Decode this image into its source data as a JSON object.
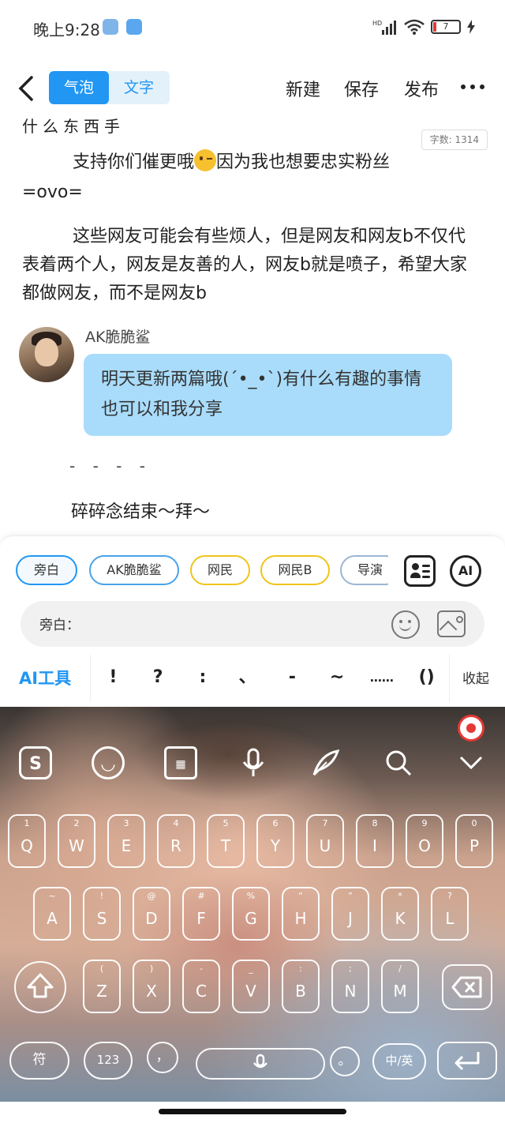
{
  "status_bar": {
    "time": "晚上9:28",
    "network": "HD",
    "battery": "7"
  },
  "header": {
    "mode_tabs": [
      "气泡",
      "文字"
    ],
    "active_tab": "气泡",
    "actions": {
      "new": "新建",
      "save": "保存",
      "publish": "发布"
    }
  },
  "editor": {
    "cut_line": "什么东西手",
    "word_count": "字数: 1314",
    "paragraph_1_before": "支持你们催更哦",
    "paragraph_1_after": "因为我也想要忠实粉丝",
    "paragraph_1_tail": "=ovo=",
    "paragraph_2": "这些网友可能会有些烦人，但是网友和网友b不仅代表着两个人，网友是友善的人，网友b就是喷子，希望大家都做网友，而不是网友b",
    "dialogue": {
      "character_name": "AK脆脆鲨",
      "message": "明天更新两篇哦(´•_•`)有什么有趣的事情也可以和我分享"
    },
    "divider": "- - - -",
    "closing": "碎碎念结束～拜～"
  },
  "character_panel": {
    "chips": [
      {
        "label": "旁白",
        "style": "sel"
      },
      {
        "label": "AK脆脆鲨",
        "style": "blue"
      },
      {
        "label": "网民",
        "style": "gold"
      },
      {
        "label": "网民B",
        "style": "gold"
      },
      {
        "label": "导演",
        "style": "grey"
      }
    ],
    "ai_button": "AI",
    "input_label": "旁白：",
    "input_value": "",
    "ai_tools_label": "AI工具",
    "punctuation": [
      "!",
      "?",
      ":",
      "、",
      "-",
      "~",
      "……",
      "()"
    ],
    "collapse_label": "收起"
  },
  "keyboard": {
    "toolbar_icons": [
      "sogou-logo-icon",
      "emoji-face-icon",
      "keyboard-icon",
      "microphone-icon",
      "quill-icon",
      "search-icon",
      "chevron-down-icon"
    ],
    "row1": [
      {
        "sub": "1",
        "main": "Q"
      },
      {
        "sub": "2",
        "main": "W"
      },
      {
        "sub": "3",
        "main": "E"
      },
      {
        "sub": "4",
        "main": "R"
      },
      {
        "sub": "5",
        "main": "T"
      },
      {
        "sub": "6",
        "main": "Y"
      },
      {
        "sub": "7",
        "main": "U"
      },
      {
        "sub": "8",
        "main": "I"
      },
      {
        "sub": "9",
        "main": "O"
      },
      {
        "sub": "0",
        "main": "P"
      }
    ],
    "row2": [
      {
        "sub": "~",
        "main": "A"
      },
      {
        "sub": "!",
        "main": "S"
      },
      {
        "sub": "@",
        "main": "D"
      },
      {
        "sub": "#",
        "main": "F"
      },
      {
        "sub": "%",
        "main": "G"
      },
      {
        "sub": "“",
        "main": "H"
      },
      {
        "sub": "”",
        "main": "J"
      },
      {
        "sub": "*",
        "main": "K"
      },
      {
        "sub": "?",
        "main": "L"
      }
    ],
    "row3": [
      {
        "sub": "(",
        "main": "Z"
      },
      {
        "sub": ")",
        "main": "X"
      },
      {
        "sub": "-",
        "main": "C"
      },
      {
        "sub": "_",
        "main": "V"
      },
      {
        "sub": ":",
        "main": "B"
      },
      {
        "sub": ";",
        "main": "N"
      },
      {
        "sub": "/",
        "main": "M"
      }
    ],
    "symbols_key": "符",
    "numbers_key": "123",
    "comma_key": "，",
    "period_key": "。",
    "lang_key": "中/英"
  }
}
